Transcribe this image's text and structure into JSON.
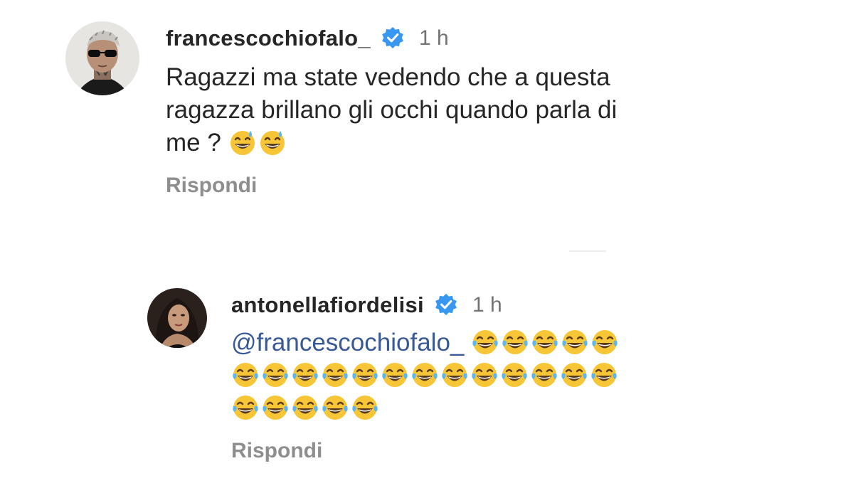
{
  "comments": [
    {
      "username": "francescochiofalo_",
      "verified": true,
      "time": "1 h",
      "text_lines": [
        "Ragazzi ma state vedendo che a questa",
        "ragazza brillano gli occhi quando parla di",
        "me ?"
      ],
      "trailing_emoji": [
        "sweat-smile-emoji",
        "sweat-smile-emoji"
      ],
      "reply_label": "Rispondi"
    },
    {
      "username": "antonellafiordelisi",
      "verified": true,
      "time": "1 h",
      "mention": "@francescochiofalo_",
      "emoji_rows": [
        5,
        13,
        5
      ],
      "emoji_name": "tears-of-joy-emoji",
      "reply_label": "Rispondi"
    }
  ],
  "colors": {
    "verified_badge": "#3897f0",
    "mention": "#385898",
    "reply": "#8e8e8e",
    "time": "#737373"
  }
}
